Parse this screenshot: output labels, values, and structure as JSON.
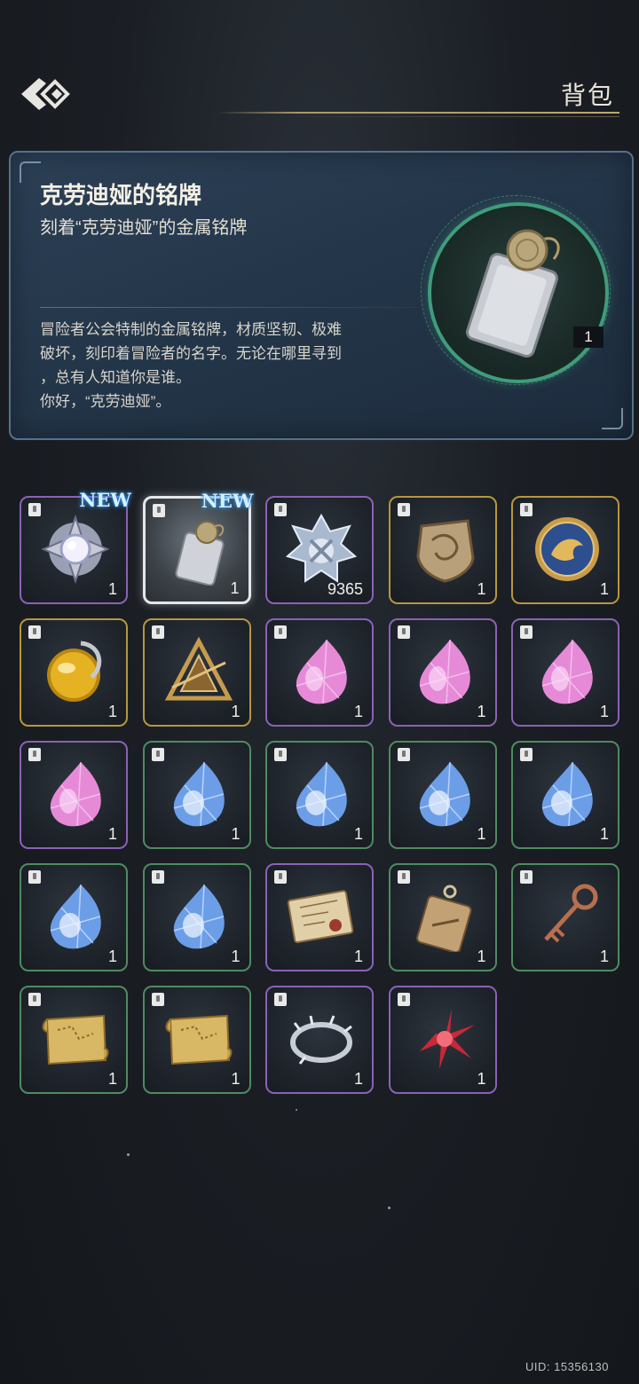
{
  "header": {
    "title": "背包"
  },
  "detail": {
    "name": "克劳迪娅的铭牌",
    "subtitle": "刻着“克劳迪娅”的金属铭牌",
    "description_lines": [
      "冒险者公会特制的金属铭牌，材质坚韧、极难",
      "破坏，刻印着冒险者的名字。无论在哪里寻到",
      "，总有人知道你是谁。",
      "你好，“克劳迪娅”。"
    ],
    "count": "1",
    "icon": "nameplate-icon"
  },
  "inventory": {
    "new_label": "NEW",
    "items": [
      {
        "icon": "moonstone-brooch-icon",
        "count": "1",
        "rarity": "purple",
        "new": true
      },
      {
        "icon": "nameplate-icon",
        "count": "1",
        "rarity": "selected",
        "new": true
      },
      {
        "icon": "silver-emblem-icon",
        "count": "9365",
        "rarity": "purple",
        "new": false
      },
      {
        "icon": "bronze-shield-token-icon",
        "count": "1",
        "rarity": "gold",
        "new": false
      },
      {
        "icon": "blue-dragon-coin-icon",
        "count": "1",
        "rarity": "gold",
        "new": false
      },
      {
        "icon": "golden-orb-icon",
        "count": "1",
        "rarity": "gold",
        "new": false
      },
      {
        "icon": "triangle-sigil-icon",
        "count": "1",
        "rarity": "gold",
        "new": false
      },
      {
        "icon": "pink-crystal-icon",
        "count": "1",
        "rarity": "purple",
        "new": false
      },
      {
        "icon": "pink-crystal-icon",
        "count": "1",
        "rarity": "purple",
        "new": false
      },
      {
        "icon": "pink-crystal-icon",
        "count": "1",
        "rarity": "purple",
        "new": false
      },
      {
        "icon": "pink-crystal-icon",
        "count": "1",
        "rarity": "purple",
        "new": false
      },
      {
        "icon": "blue-crystal-icon",
        "count": "1",
        "rarity": "green",
        "new": false
      },
      {
        "icon": "blue-crystal-icon",
        "count": "1",
        "rarity": "green",
        "new": false
      },
      {
        "icon": "blue-crystal-icon",
        "count": "1",
        "rarity": "green",
        "new": false
      },
      {
        "icon": "blue-crystal-icon",
        "count": "1",
        "rarity": "green",
        "new": false
      },
      {
        "icon": "blue-crystal-icon",
        "count": "1",
        "rarity": "green",
        "new": false
      },
      {
        "icon": "blue-crystal-icon",
        "count": "1",
        "rarity": "green",
        "new": false
      },
      {
        "icon": "letter-icon",
        "count": "1",
        "rarity": "purple",
        "new": false
      },
      {
        "icon": "wooden-tag-icon",
        "count": "1",
        "rarity": "green",
        "new": false
      },
      {
        "icon": "ornate-key-icon",
        "count": "1",
        "rarity": "green",
        "new": false
      },
      {
        "icon": "treasure-map-icon",
        "count": "1",
        "rarity": "green",
        "new": false
      },
      {
        "icon": "treasure-map-icon",
        "count": "1",
        "rarity": "green",
        "new": false
      },
      {
        "icon": "thorn-ring-icon",
        "count": "1",
        "rarity": "purple",
        "new": false
      },
      {
        "icon": "red-flower-icon",
        "count": "1",
        "rarity": "purple",
        "new": false
      }
    ]
  },
  "footer": {
    "uid": "UID: 15356130"
  },
  "colors": {
    "purple_border": "#8a62b3",
    "gold_border": "#b6963f",
    "green_border": "#4f8a62",
    "new_glow": "#37a6ff",
    "portrait_ring": "#3f9d7a"
  }
}
